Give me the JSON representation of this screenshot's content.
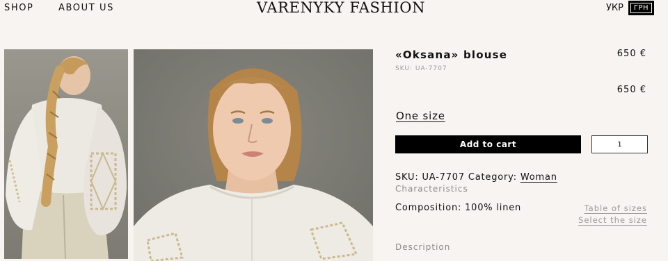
{
  "header": {
    "nav": [
      {
        "label": "SHOP"
      },
      {
        "label": "ABOUT US"
      }
    ],
    "logo": "VARENYKY FASHION",
    "language": "УКР",
    "currency": "ГРН"
  },
  "product": {
    "title": "«Oksana» blouse",
    "price": "650 €",
    "sku_small": "SKU: UA-7707",
    "price_secondary": "650 €",
    "size": "One size",
    "add_to_cart": "Add to cart",
    "quantity": "1",
    "sku_label": "SKU: UA-7707",
    "category_label": "Category:",
    "category": "Woman",
    "characteristics_heading": "Characteristics",
    "composition": "Composition: 100% linen",
    "table_of_sizes": "Table of sizes",
    "select_size": "Select the size",
    "description_heading": "Description"
  },
  "images": [
    {
      "icon": "model-back-view-photo",
      "alt_role": "product photo back view"
    },
    {
      "icon": "model-front-portrait-photo",
      "alt_role": "product photo front portrait"
    }
  ],
  "colors": {
    "background": "#f7f4f2",
    "button": "#000000",
    "muted_text": "#9a9a9a"
  }
}
